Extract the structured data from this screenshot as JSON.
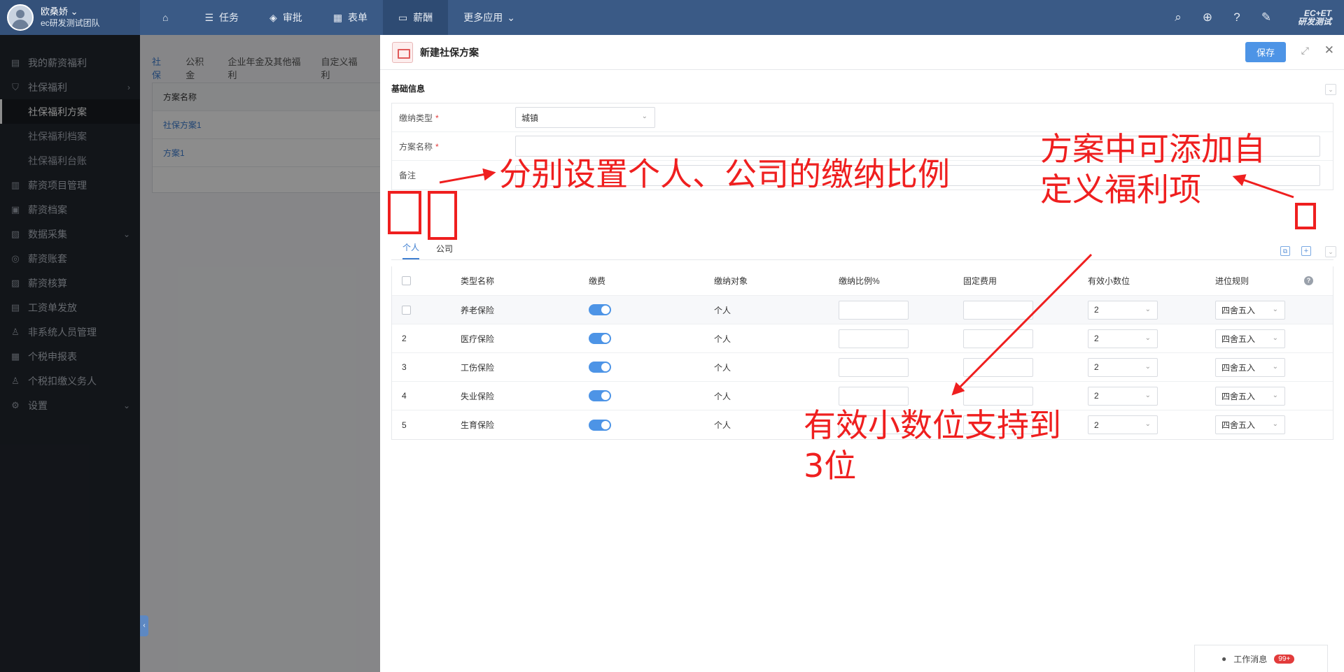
{
  "user": {
    "name": "欧桑娇",
    "team": "ec研发测试团队"
  },
  "nav": {
    "items": [
      {
        "label": "",
        "icon": "home-icon"
      },
      {
        "label": "任务",
        "icon": "list-icon"
      },
      {
        "label": "审批",
        "icon": "stack-icon"
      },
      {
        "label": "表单",
        "icon": "table-icon"
      },
      {
        "label": "薪酬",
        "icon": "card-icon"
      },
      {
        "label": "更多应用",
        "icon": "chevron-down-icon"
      }
    ],
    "active": "薪酬"
  },
  "brand": {
    "line1": "EC+ET",
    "line2": "研发测试"
  },
  "sidebar": {
    "items": [
      {
        "label": "我的薪资福利",
        "icon": "wallet-icon"
      },
      {
        "label": "社保福利",
        "icon": "shield-icon",
        "arrow": "›"
      },
      {
        "label": "社保福利方案",
        "sub": true,
        "active": true
      },
      {
        "label": "社保福利档案",
        "sub": true
      },
      {
        "label": "社保福利台账",
        "sub": true
      },
      {
        "label": "薪资项目管理",
        "icon": "project-icon"
      },
      {
        "label": "薪资档案",
        "icon": "folder-icon"
      },
      {
        "label": "数据采集",
        "icon": "data-icon",
        "arrow": "⌄"
      },
      {
        "label": "薪资账套",
        "icon": "book-icon"
      },
      {
        "label": "薪资核算",
        "icon": "calc-icon"
      },
      {
        "label": "工资单发放",
        "icon": "payslip-icon"
      },
      {
        "label": "非系统人员管理",
        "icon": "person-icon"
      },
      {
        "label": "个税申报表",
        "icon": "report-icon"
      },
      {
        "label": "个税扣缴义务人",
        "icon": "person-icon"
      },
      {
        "label": "设置",
        "icon": "gear-icon",
        "arrow": "⌄"
      }
    ]
  },
  "middle": {
    "tabs": [
      "社保",
      "公积金",
      "企业年金及其他福利",
      "自定义福利"
    ],
    "column": "方案名称",
    "rows": [
      "社保方案1",
      "方案1"
    ]
  },
  "drawer": {
    "title": "新建社保方案",
    "save_label": "保存",
    "section_title": "基础信息",
    "form": {
      "type_label": "缴纳类型",
      "type_value": "城镇",
      "name_label": "方案名称",
      "name_value": "",
      "remark_label": "备注",
      "remark_value": ""
    },
    "tabs": [
      "个人",
      "公司"
    ],
    "active_tab": "个人",
    "columns": [
      "类型名称",
      "缴费",
      "缴纳对象",
      "缴纳比例%",
      "固定费用",
      "有效小数位",
      "进位规则"
    ],
    "rows": [
      {
        "index": "",
        "name": "养老保险",
        "pay": true,
        "target": "个人",
        "ratio": "",
        "fixed": "",
        "decimal": "2",
        "rule": "四舍五入"
      },
      {
        "index": "2",
        "name": "医疗保险",
        "pay": true,
        "target": "个人",
        "ratio": "",
        "fixed": "",
        "decimal": "2",
        "rule": "四舍五入"
      },
      {
        "index": "3",
        "name": "工伤保险",
        "pay": true,
        "target": "个人",
        "ratio": "",
        "fixed": "",
        "decimal": "2",
        "rule": "四舍五入"
      },
      {
        "index": "4",
        "name": "失业保险",
        "pay": true,
        "target": "个人",
        "ratio": "",
        "fixed": "",
        "decimal": "2",
        "rule": "四舍五入"
      },
      {
        "index": "5",
        "name": "生育保险",
        "pay": true,
        "target": "个人",
        "ratio": "",
        "fixed": "",
        "decimal": "2",
        "rule": "四舍五入"
      }
    ]
  },
  "annotations": {
    "note1": "分别设置个人、公司的缴纳比例",
    "note2_line1": "方案中可添加自",
    "note2_line2": "定义福利项",
    "note3_line1": "有效小数位支持到",
    "note3_line2": "3位",
    "color": "#ef1f1f"
  },
  "work_message": {
    "label": "工作消息",
    "badge": "99+"
  },
  "colors": {
    "topbar": "#3a5a86",
    "sidebar": "#22272f",
    "accent": "#4d94e6"
  }
}
